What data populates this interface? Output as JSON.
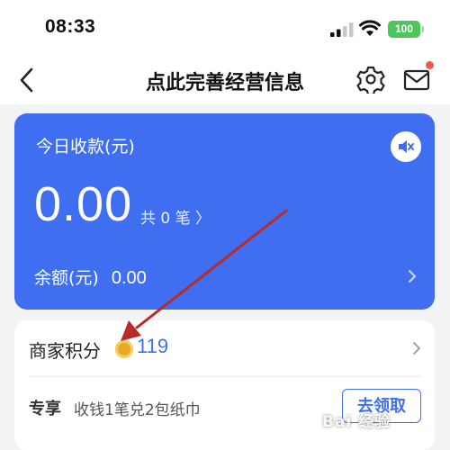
{
  "status_bar": {
    "time": "08:33",
    "battery": "100",
    "icons": [
      "signal-icon",
      "wifi-icon",
      "battery-icon"
    ]
  },
  "nav": {
    "title": "点此完善经营信息",
    "icons": [
      "back-icon",
      "settings-icon",
      "mail-icon"
    ]
  },
  "income_card": {
    "label": "今日收款(元)",
    "amount": "0.00",
    "count_text": "共 0 笔 〉",
    "balance_label": "余额(元)",
    "balance_value": "0.00",
    "icons": [
      "mute-icon",
      "chevron-right-icon"
    ]
  },
  "points_card": {
    "label": "商家积分",
    "value": "119",
    "exclusive_tag": "专享",
    "promo_text": "收钱1笔兑2包纸巾",
    "claim_label": "去领取",
    "icons": [
      "coin-icon",
      "chevron-right-icon"
    ]
  },
  "watermark": "Bai 经验",
  "colors": {
    "brand_blue": "#3f6ff0",
    "notify_red": "#ef5a4c",
    "arrow_red": "#b92b27",
    "coin_gold": "#e6a92a",
    "battery_green": "#4cc65b"
  }
}
